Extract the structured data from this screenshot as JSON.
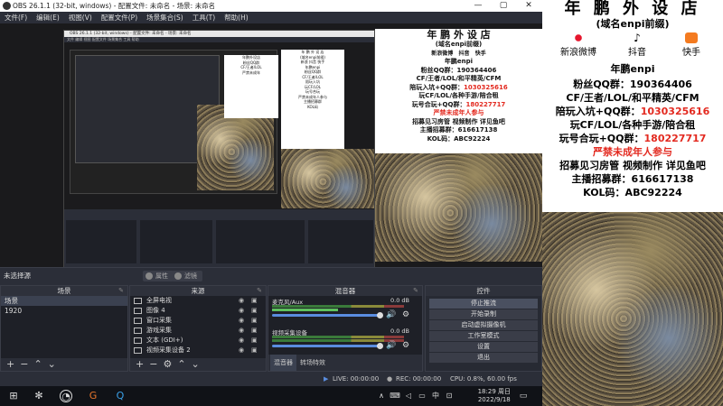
{
  "window": {
    "title": "OBS 26.1.1 (32-bit, windows) - 配置文件: 未命名 - 场景: 未命名"
  },
  "menu": [
    "文件(F)",
    "编辑(E)",
    "视图(V)",
    "配置文件(P)",
    "场景集合(S)",
    "工具(T)",
    "帮助(H)"
  ],
  "dockbar": {
    "no_source": "未选择源",
    "properties": "属性",
    "filters": "滤镜"
  },
  "scenes": {
    "title": "场景",
    "items": [
      "场景",
      "1920"
    ]
  },
  "sources": {
    "title": "来源",
    "items": [
      {
        "icon": "monitor-icon",
        "name": "全屏电视"
      },
      {
        "icon": "image-icon",
        "name": "图像 4"
      },
      {
        "icon": "window-icon",
        "name": "窗口采集"
      },
      {
        "icon": "gamepad-icon",
        "name": "游戏采集"
      },
      {
        "icon": "text-icon",
        "name": "文本 (GDI+)"
      },
      {
        "icon": "camera-icon",
        "name": "视频采集设备 2"
      }
    ]
  },
  "mixer": {
    "title": "混音器",
    "channels": [
      {
        "name": "麦克风/Aux",
        "db": "0.0 dB",
        "level": 0.5
      },
      {
        "name": "视频采集设备",
        "db": "0.0 dB",
        "level": 0.3
      }
    ],
    "tabs": [
      "混音器",
      "转场特效"
    ]
  },
  "controls": {
    "title": "控件",
    "buttons": [
      "停止推流",
      "开始录制",
      "启动虚拟摄像机",
      "工作室模式",
      "设置",
      "退出"
    ]
  },
  "status": {
    "live": "LIVE: 00:00:00",
    "rec": "REC: 00:00:00",
    "cpu": "CPU: 0.8%, 60.00 fps"
  },
  "taskbar": {
    "time": "18:29 周日",
    "date": "2022/9/18"
  },
  "ad": {
    "title": "年 鹏 外 设 店",
    "subtitle": "(域名enpi前缀)",
    "socials": [
      "新浪微博",
      "抖音",
      "快手"
    ],
    "nick": "年鹏enpi",
    "lines": [
      {
        "text": "粉丝QQ群：190364406",
        "red": false
      },
      {
        "text": "CF/王者/LOL/和平精英/CFM",
        "red": false
      },
      {
        "text": "陪玩入坑+QQ群：",
        "red": false,
        "tail": "1030325616"
      },
      {
        "text": "玩CF/LOL/各种手游/陪合租",
        "red": false
      },
      {
        "text": "玩号合玩+QQ群：",
        "red": false,
        "tail": "180227717"
      },
      {
        "text": "严禁未成年人参与",
        "red": true
      },
      {
        "text": "招募见习房管 视频制作 详见鱼吧",
        "red": false,
        "mixed": true
      },
      {
        "text": "主播招募群：616617138",
        "red": false
      },
      {
        "text": "KOL码：ABC92224",
        "red": false
      }
    ]
  },
  "colors": {
    "obs_bg": "#2b2e38",
    "accent_red": "#e32a20"
  }
}
